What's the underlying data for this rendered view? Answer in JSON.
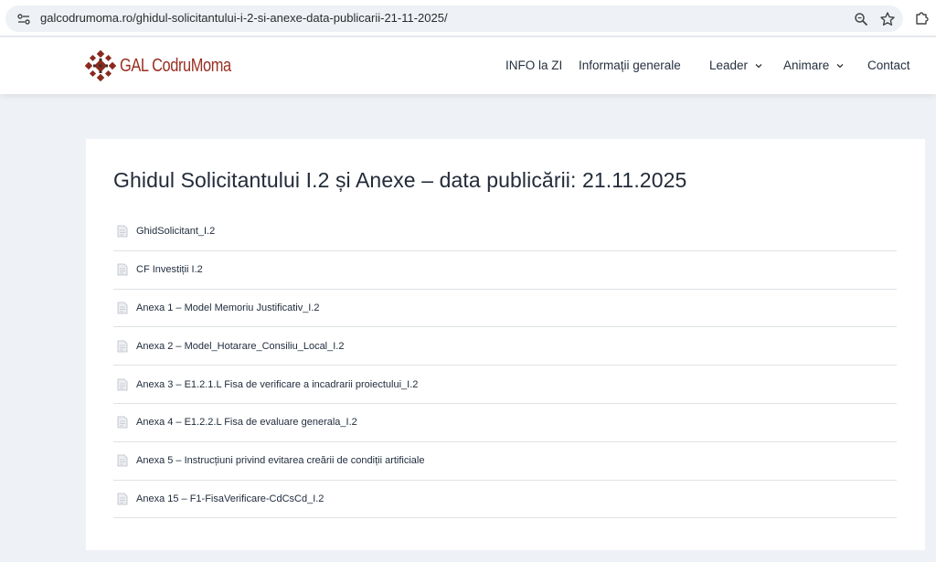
{
  "browser": {
    "url": "galcodrumoma.ro/ghidul-solicitantului-i-2-si-anexe-data-publicarii-21-11-2025/"
  },
  "header": {
    "logo_text": "GAL CodruMoma",
    "nav": [
      {
        "label": "INFO la ZI"
      },
      {
        "label": "Informații generale"
      },
      {
        "label": "Leader"
      },
      {
        "label": "Animare"
      },
      {
        "label": "Contact"
      }
    ]
  },
  "main": {
    "title": "Ghidul Solicitantului I.2 și Anexe – data publicării: 21.11.2025",
    "documents": [
      {
        "label": "GhidSolicitant_I.2"
      },
      {
        "label": "CF Investiții I.2"
      },
      {
        "label": "Anexa 1 – Model Memoriu Justificativ_I.2"
      },
      {
        "label": "Anexa 2 – Model_Hotarare_Consiliu_Local_I.2"
      },
      {
        "label": "Anexa 3 – E1.2.1.L Fisa de verificare a incadrarii proiectului_I.2"
      },
      {
        "label": "Anexa 4 – E1.2.2.L Fisa de evaluare generala_I.2"
      },
      {
        "label": "Anexa 5 – Instrucțiuni privind evitarea creării de condiții artificiale"
      },
      {
        "label": "Anexa 15 – F1-FisaVerificare-CdCsCd_I.2"
      }
    ]
  },
  "colors": {
    "brand": "#9a2f22",
    "page_bg": "#eef1f5",
    "text_dark": "#232b39"
  },
  "icons": [
    "site-info-icon",
    "zoom-icon",
    "star-icon",
    "extensions-icon",
    "chevron-down-icon",
    "document-icon"
  ]
}
